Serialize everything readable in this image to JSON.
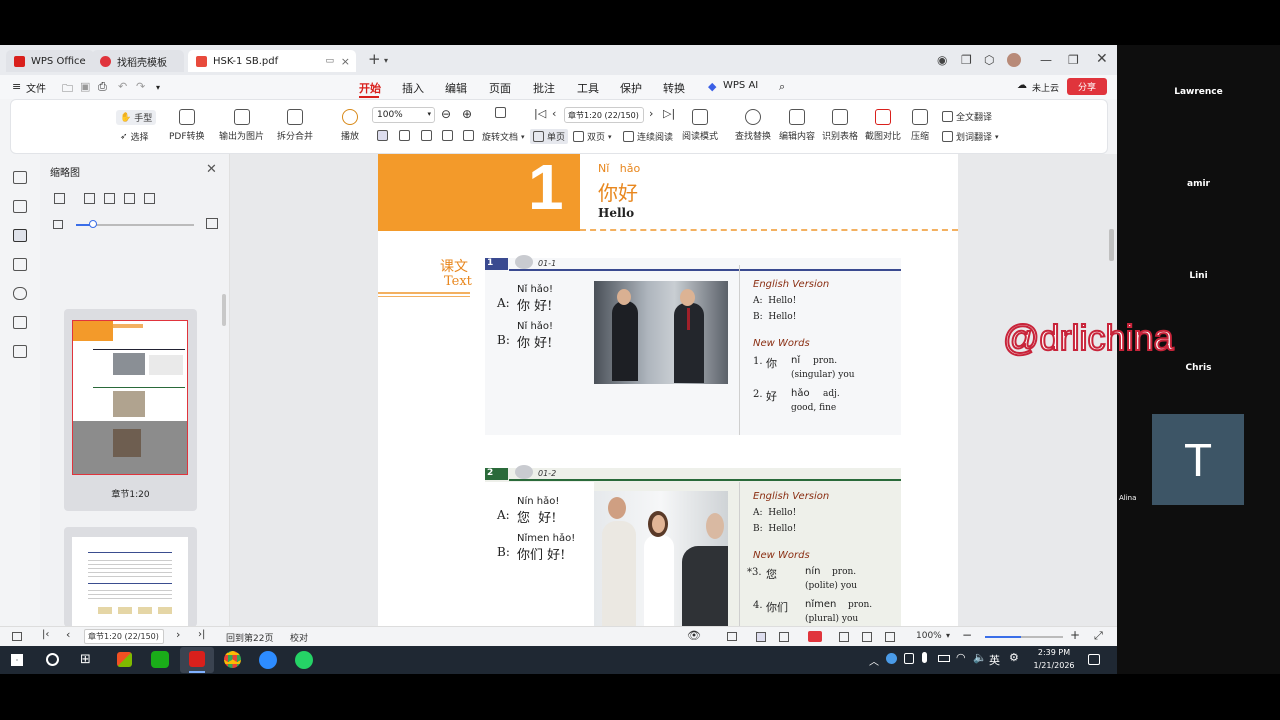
{
  "tabs": [
    {
      "label": "WPS Office"
    },
    {
      "label": "找稻壳模板"
    },
    {
      "label": "HSK-1 SB.pdf"
    }
  ],
  "menubar": {
    "file": "文件",
    "items": [
      "开始",
      "插入",
      "编辑",
      "页面",
      "批注",
      "工具",
      "保护",
      "转换"
    ],
    "wps_ai": "WPS AI",
    "cloud": "未上云",
    "share": "分享"
  },
  "ribbon": {
    "hand": "手型",
    "select": "选择",
    "pdf_convert": "PDF转换",
    "export_image": "输出为图片",
    "split_merge": "拆分合并",
    "play": "播放",
    "zoom": "100%",
    "rotate": "旋转文档",
    "single": "单页",
    "double": "双页",
    "continuous": "连续阅读",
    "chapter": "章节1:20 (22/150)",
    "read_mode": "阅读模式",
    "find_replace": "查找替换",
    "edit_content": "编辑内容",
    "recognize_table": "识别表格",
    "screenshot_compare": "截图对比",
    "compress": "压缩",
    "full_translate": "全文翻译",
    "word_translate": "划词翻译"
  },
  "thumbs": {
    "title": "缩略图",
    "page1_label": "章节1:20"
  },
  "page": {
    "lesson_num": "1",
    "pinyin_title": "Nǐ   hǎo",
    "cn_title": "你好",
    "en_title": "Hello",
    "section_cn": "课文",
    "section_en": "Text",
    "d1": {
      "num": "1",
      "audio": "01-1",
      "a_pinyin": "Nǐ hǎo!",
      "a_label": "A:",
      "a_cn": "你 好!",
      "b_pinyin": "Nǐ hǎo!",
      "b_label": "B:",
      "b_cn": "你 好!",
      "eng_title": "English Version",
      "eng_a": "A:  Hello!",
      "eng_b": "B:  Hello!",
      "nw_title": "New Words",
      "w1_num": "1.",
      "w1_cn": "你",
      "w1_py": "nǐ",
      "w1_pos": "pron.",
      "w1_def": "(singular) you",
      "w2_num": "2.",
      "w2_cn": "好",
      "w2_py": "hǎo",
      "w2_pos": "adj.",
      "w2_def": "good, fine"
    },
    "d2": {
      "num": "2",
      "audio": "01-2",
      "a_pinyin": "Nín hǎo!",
      "a_label": "A:",
      "a_cn": "您  好!",
      "b_pinyin": "Nǐmen hǎo!",
      "b_label": "B:",
      "b_cn": "你们 好!",
      "eng_title": "English Version",
      "eng_a": "A:  Hello!",
      "eng_b": "B:  Hello!",
      "nw_title": "New Words",
      "w3_num": "*3.",
      "w3_cn": "您",
      "w3_py": "nín",
      "w3_pos": "pron.",
      "w3_def": "(polite) you",
      "w4_num": "4.",
      "w4_cn": "你们",
      "w4_py": "nǐmen",
      "w4_pos": "pron.",
      "w4_def": "(plural) you"
    }
  },
  "status": {
    "chapter": "章节1:20 (22/150)",
    "back": "回到第22页",
    "proof": "校对",
    "zoom": "100%"
  },
  "taskbar": {
    "lang": "英",
    "time": "2:39 PM",
    "date": "1/21/2026"
  },
  "participants": {
    "p1": "Lawrence",
    "p2": "amir",
    "p3": "Lini",
    "p4": "Chris",
    "p5_initial": "T",
    "p5": "Alina"
  },
  "watermark": "@drlichina"
}
